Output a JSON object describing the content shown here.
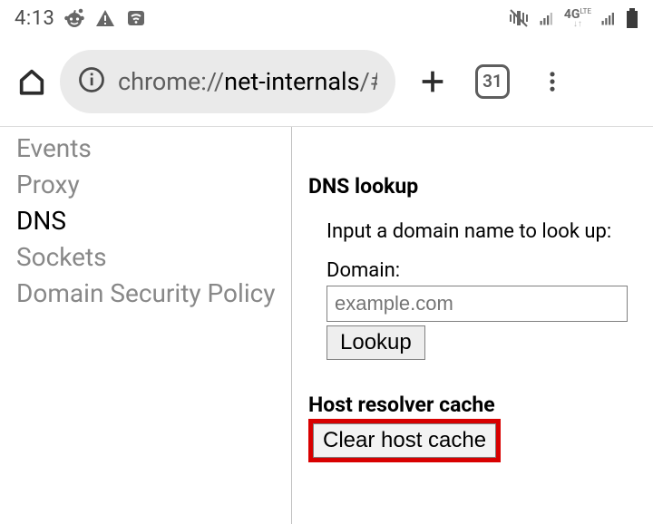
{
  "status": {
    "time": "4:13",
    "network_label": "4G",
    "network_sub": "LTE"
  },
  "browser": {
    "tab_count": "31",
    "url_pre": "chrome://",
    "url_dark": "net-internals",
    "url_post": "/#dn"
  },
  "sidebar": {
    "items": [
      {
        "label": "Events"
      },
      {
        "label": "Proxy"
      },
      {
        "label": "DNS"
      },
      {
        "label": "Sockets"
      },
      {
        "label": "Domain Security Policy"
      }
    ],
    "active_index": 2
  },
  "dns": {
    "section_title": "DNS lookup",
    "help_text": "Input a domain name to look up:",
    "domain_label": "Domain:",
    "domain_placeholder": "example.com",
    "lookup_label": "Lookup",
    "cache_title": "Host resolver cache",
    "clear_cache_label": "Clear host cache"
  }
}
